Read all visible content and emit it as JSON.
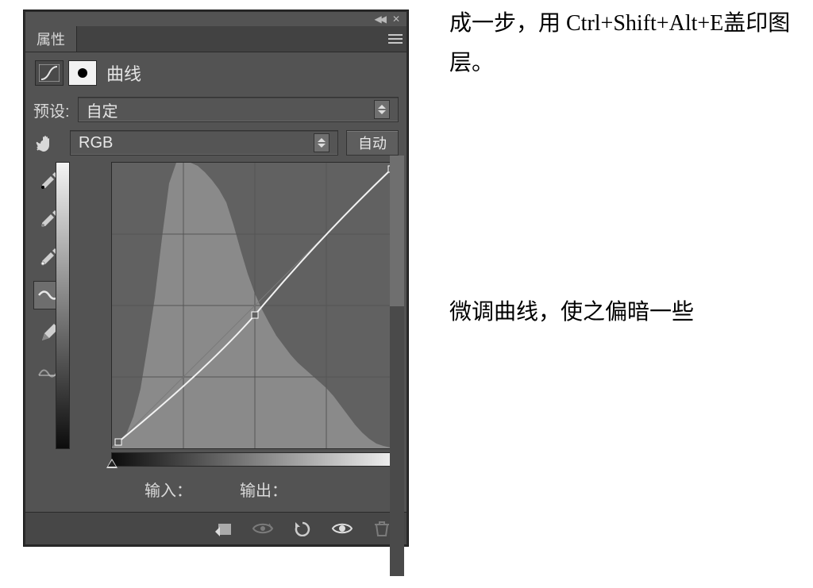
{
  "panel": {
    "tab_label": "属性",
    "adjustment_label": "曲线",
    "preset_label": "预设:",
    "preset_value": "自定",
    "channel_value": "RGB",
    "auto_button": "自动",
    "input_label": "输入：",
    "output_label": "输出：",
    "icons": {
      "curves_icon": "curves-icon",
      "mask_icon": "mask-icon",
      "hand_icon": "hand-icon",
      "eyedrop_black": "eyedropper-black-icon",
      "eyedrop_gray": "eyedropper-gray-icon",
      "eyedrop_white": "eyedropper-white-icon",
      "curve_tool": "curve-tool-icon",
      "pencil_tool": "pencil-tool-icon",
      "smooth_tool": "smooth-tool-icon"
    },
    "bottom": {
      "clip_icon": "clip-to-layer-icon",
      "view_prev_icon": "view-previous-icon",
      "reset_icon": "reset-icon",
      "visibility_icon": "visibility-icon",
      "trash_icon": "trash-icon"
    }
  },
  "instructions": {
    "line1": "成一步，用 Ctrl+Shift+Alt+E盖印图层。",
    "line2": "微调曲线，使之偏暗一些"
  },
  "chart_data": {
    "type": "line",
    "title": "曲线 (Curves)",
    "xlabel": "输入",
    "ylabel": "输出",
    "x_range": [
      0,
      255
    ],
    "y_range": [
      0,
      255
    ],
    "histogram_bins": [
      0,
      2,
      4,
      8,
      16,
      30,
      55,
      90,
      140,
      200,
      255,
      255,
      250,
      240,
      230,
      220,
      200,
      175,
      150,
      130,
      115,
      100,
      90,
      80,
      72,
      66,
      60,
      54,
      50,
      46,
      42,
      36,
      28,
      20,
      12,
      6,
      3,
      1,
      0
    ],
    "curve_points": [
      [
        0,
        0
      ],
      [
        128,
        118
      ],
      [
        255,
        255
      ]
    ],
    "note": "curve slightly below the diagonal at the midpoint → darker output"
  }
}
